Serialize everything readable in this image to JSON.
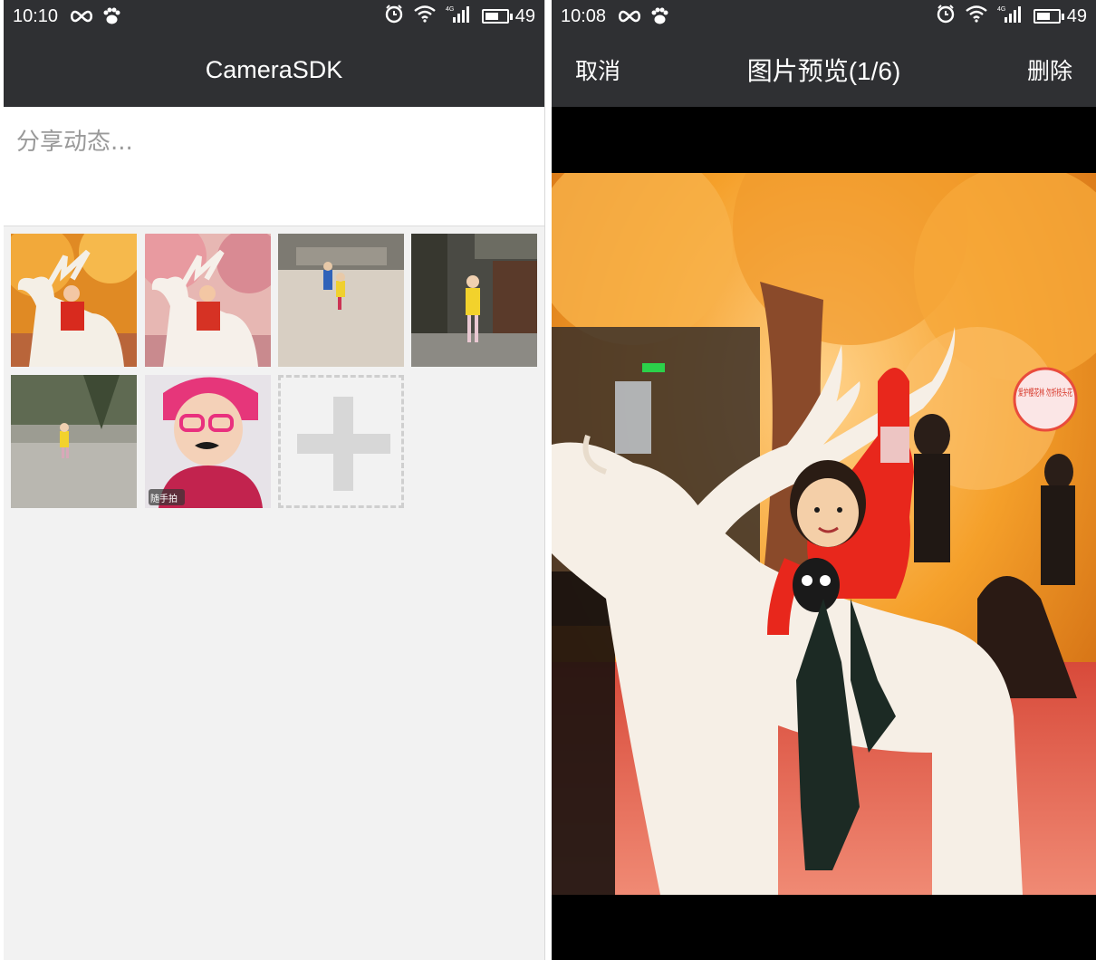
{
  "left": {
    "status": {
      "time": "10:10",
      "battery": "49",
      "network": "4G"
    },
    "title": "CameraSDK",
    "compose": {
      "placeholder": "分享动态..."
    },
    "thumbnails": [
      {
        "subject": "girl-on-white-deer-statue"
      },
      {
        "subject": "girl-on-white-deer-statue-pink"
      },
      {
        "subject": "children-running-on-path"
      },
      {
        "subject": "girl-in-yellow-by-tree"
      },
      {
        "subject": "child-on-stone-path"
      },
      {
        "subject": "girl-with-pink-glasses",
        "watermark": "随手拍"
      }
    ],
    "add_icon": "plus-icon"
  },
  "right": {
    "status": {
      "time": "10:08",
      "battery": "49",
      "network": "4G"
    },
    "cancel_label": "取消",
    "title": "图片预览(1/6)",
    "delete_label": "删除",
    "sign_text": "爱护樱花林 勿折枝头花"
  },
  "colors": {
    "bar": "#2f3033",
    "page_background": "#f2f2f2",
    "placeholder_text": "#9a9a9a",
    "add_tile": "#d7d7d7"
  }
}
